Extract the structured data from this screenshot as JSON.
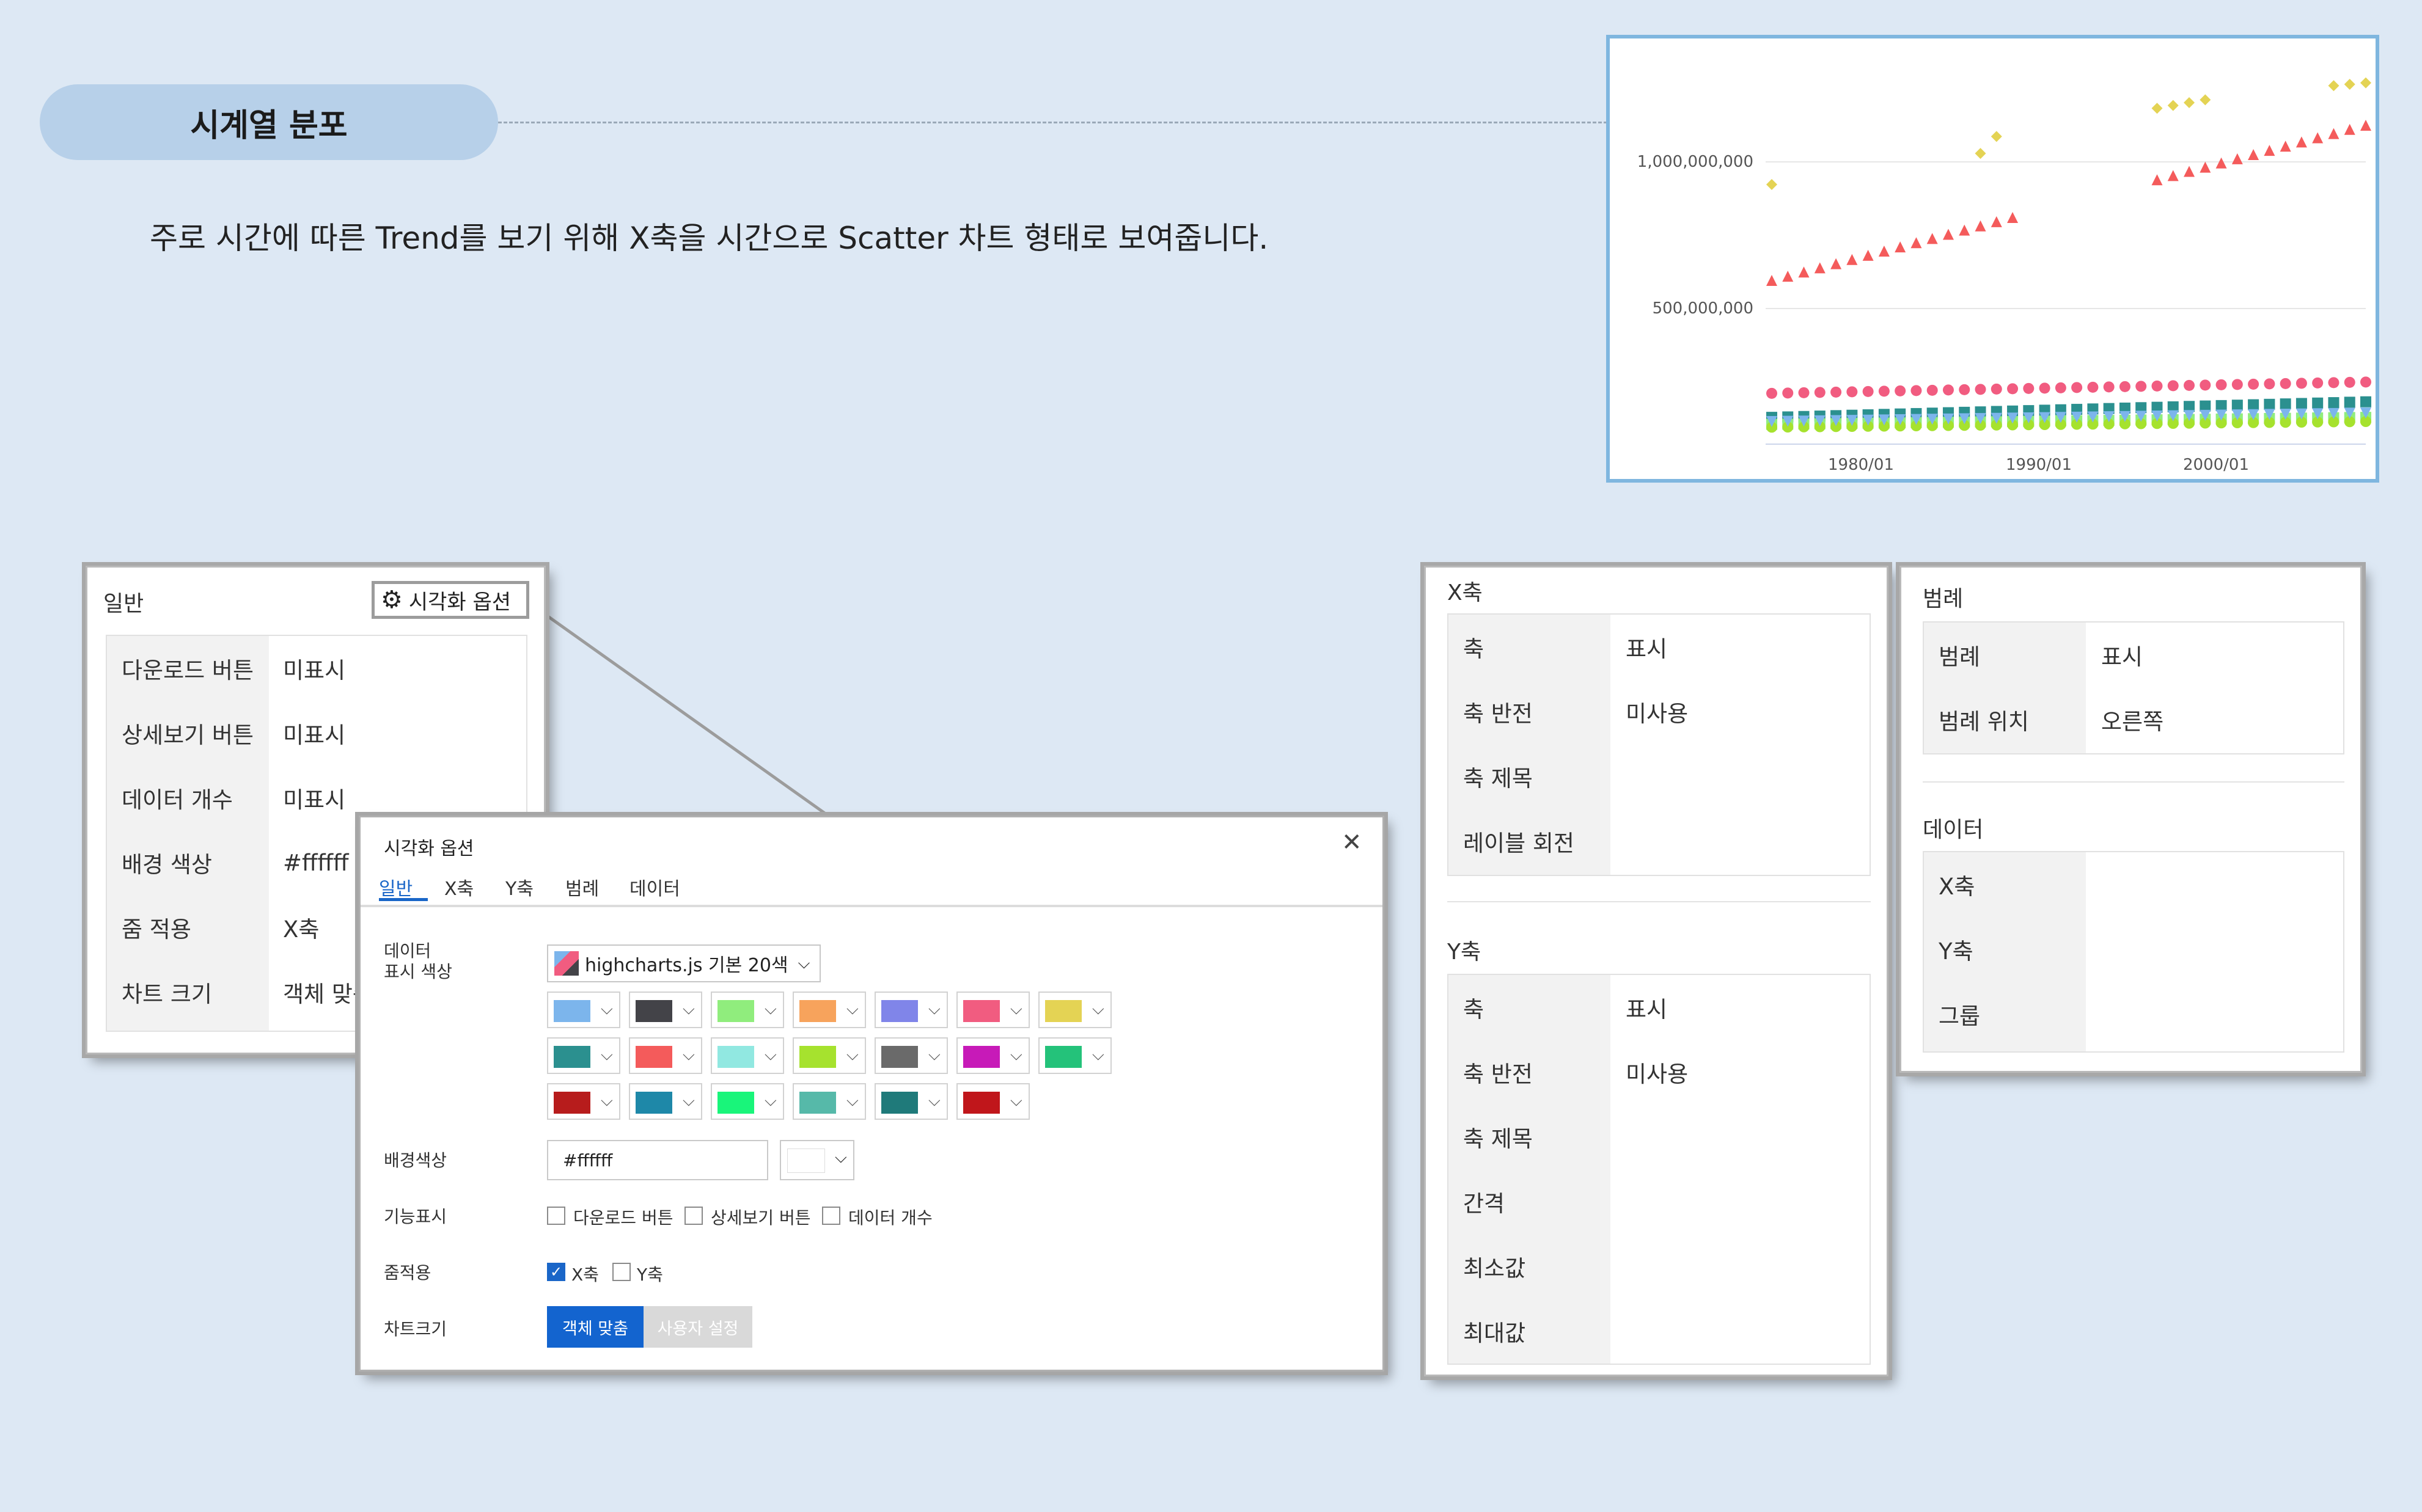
{
  "header": {
    "title": "시계열 분포",
    "description": "주로 시간에 따른 Trend를 보기 위해 X축을 시간으로 Scatter 차트 형태로 보여줍니다."
  },
  "chart_data": {
    "type": "scatter",
    "x_ticks": [
      "1980/01",
      "1990/01",
      "2000/01"
    ],
    "y_ticks": [
      "1,000,000,000",
      "500,000,000"
    ],
    "ylim": [
      0,
      1200000000
    ],
    "xlim": [
      "1975/01",
      "2010/01"
    ],
    "grid": true,
    "series": [
      {
        "marker": "diamond",
        "color": "#e4d354",
        "points": [
          [
            1973,
            920000000
          ],
          [
            1986,
            1030000000
          ],
          [
            1987,
            1090000000
          ],
          [
            1997,
            1190000000
          ],
          [
            1998,
            1200000000
          ],
          [
            1999,
            1210000000
          ],
          [
            2000,
            1220000000
          ],
          [
            2008,
            1270000000
          ],
          [
            2009,
            1275000000
          ],
          [
            2010,
            1280000000
          ]
        ]
      },
      {
        "marker": "triangle",
        "color": "#f45b5b",
        "first_year": 1973,
        "last_year": 2010,
        "gap": [
          1989,
          1996
        ],
        "start": 580000000,
        "end": 1130000000
      },
      {
        "marker": "circle",
        "color": "#f15c80",
        "first_year": 1973,
        "last_year": 2010,
        "start": 180000000,
        "end": 220000000
      },
      {
        "marker": "square",
        "color": "#2b908f",
        "first_year": 1973,
        "last_year": 2010,
        "start": 95000000,
        "end": 150000000
      },
      {
        "marker": "square",
        "color": "#90ed7d",
        "first_year": 1973,
        "last_year": 2010,
        "start": 70000000,
        "end": 95000000
      },
      {
        "marker": "circle",
        "color": "#a6e22e",
        "first_year": 1973,
        "last_year": 2010,
        "start": 60000000,
        "end": 80000000
      },
      {
        "marker": "triangle-down",
        "color": "#7cb5ec",
        "first_year": 1973,
        "last_year": 2010,
        "start": 80000000,
        "end": 110000000
      }
    ]
  },
  "general_panel": {
    "title": "일반",
    "viz_options_button": "시각화 옵션",
    "rows": [
      {
        "label": "다운로드 버튼",
        "value": "미표시"
      },
      {
        "label": "상세보기 버튼",
        "value": "미표시"
      },
      {
        "label": "데이터 개수",
        "value": "미표시"
      },
      {
        "label": "배경 색상",
        "value": "#ffffff"
      },
      {
        "label": "줌 적용",
        "value": "X축"
      },
      {
        "label": "차트 크기",
        "value": "객체 맞춤"
      }
    ]
  },
  "dialog": {
    "title": "시각화 옵션",
    "tabs": [
      "일반",
      "X축",
      "Y축",
      "범례",
      "데이터"
    ],
    "data_color_label": "데이터\n표시 색상",
    "palette": "highcharts.js 기본 20색",
    "colors": [
      "#7cb5ec",
      "#434348",
      "#90ed7d",
      "#f7a35c",
      "#8085e9",
      "#f15c80",
      "#e4d354",
      "#2b908f",
      "#f45b5b",
      "#91e8e1",
      "#a6e22e",
      "#6a6a6a",
      "#c71ab8",
      "#24c27a",
      "#b71c1c",
      "#1e88a8",
      "#19f57a",
      "#56b9a9",
      "#1f7a7a",
      "#c0161b"
    ],
    "bg_label": "배경색상",
    "bg_value": "#ffffff",
    "features_label": "기능표시",
    "features": [
      "다운로드 버튼",
      "상세보기 버튼",
      "데이터 개수"
    ],
    "zoom_label": "줌적용",
    "zoom": [
      {
        "label": "X축",
        "checked": true
      },
      {
        "label": "Y축",
        "checked": false
      }
    ],
    "size_label": "차트크기",
    "size_buttons": [
      "객체 맞춤",
      "사용자 설정"
    ]
  },
  "axis_panel": {
    "x_title": "X축",
    "x_rows": [
      {
        "label": "축",
        "value": "표시"
      },
      {
        "label": "축 반전",
        "value": "미사용"
      },
      {
        "label": "축 제목",
        "value": ""
      },
      {
        "label": "레이블 회전",
        "value": ""
      }
    ],
    "y_title": "Y축",
    "y_rows": [
      {
        "label": "축",
        "value": "표시"
      },
      {
        "label": "축 반전",
        "value": "미사용"
      },
      {
        "label": "축 제목",
        "value": ""
      },
      {
        "label": "간격",
        "value": ""
      },
      {
        "label": "최소값",
        "value": ""
      },
      {
        "label": "최대값",
        "value": ""
      }
    ]
  },
  "legend_panel": {
    "legend_title": "범례",
    "legend_rows": [
      {
        "label": "범례",
        "value": "표시"
      },
      {
        "label": "범례 위치",
        "value": "오른쪽"
      }
    ],
    "data_title": "데이터",
    "data_rows": [
      {
        "label": "X축",
        "value": ""
      },
      {
        "label": "Y축",
        "value": ""
      },
      {
        "label": "그룹",
        "value": ""
      }
    ]
  }
}
